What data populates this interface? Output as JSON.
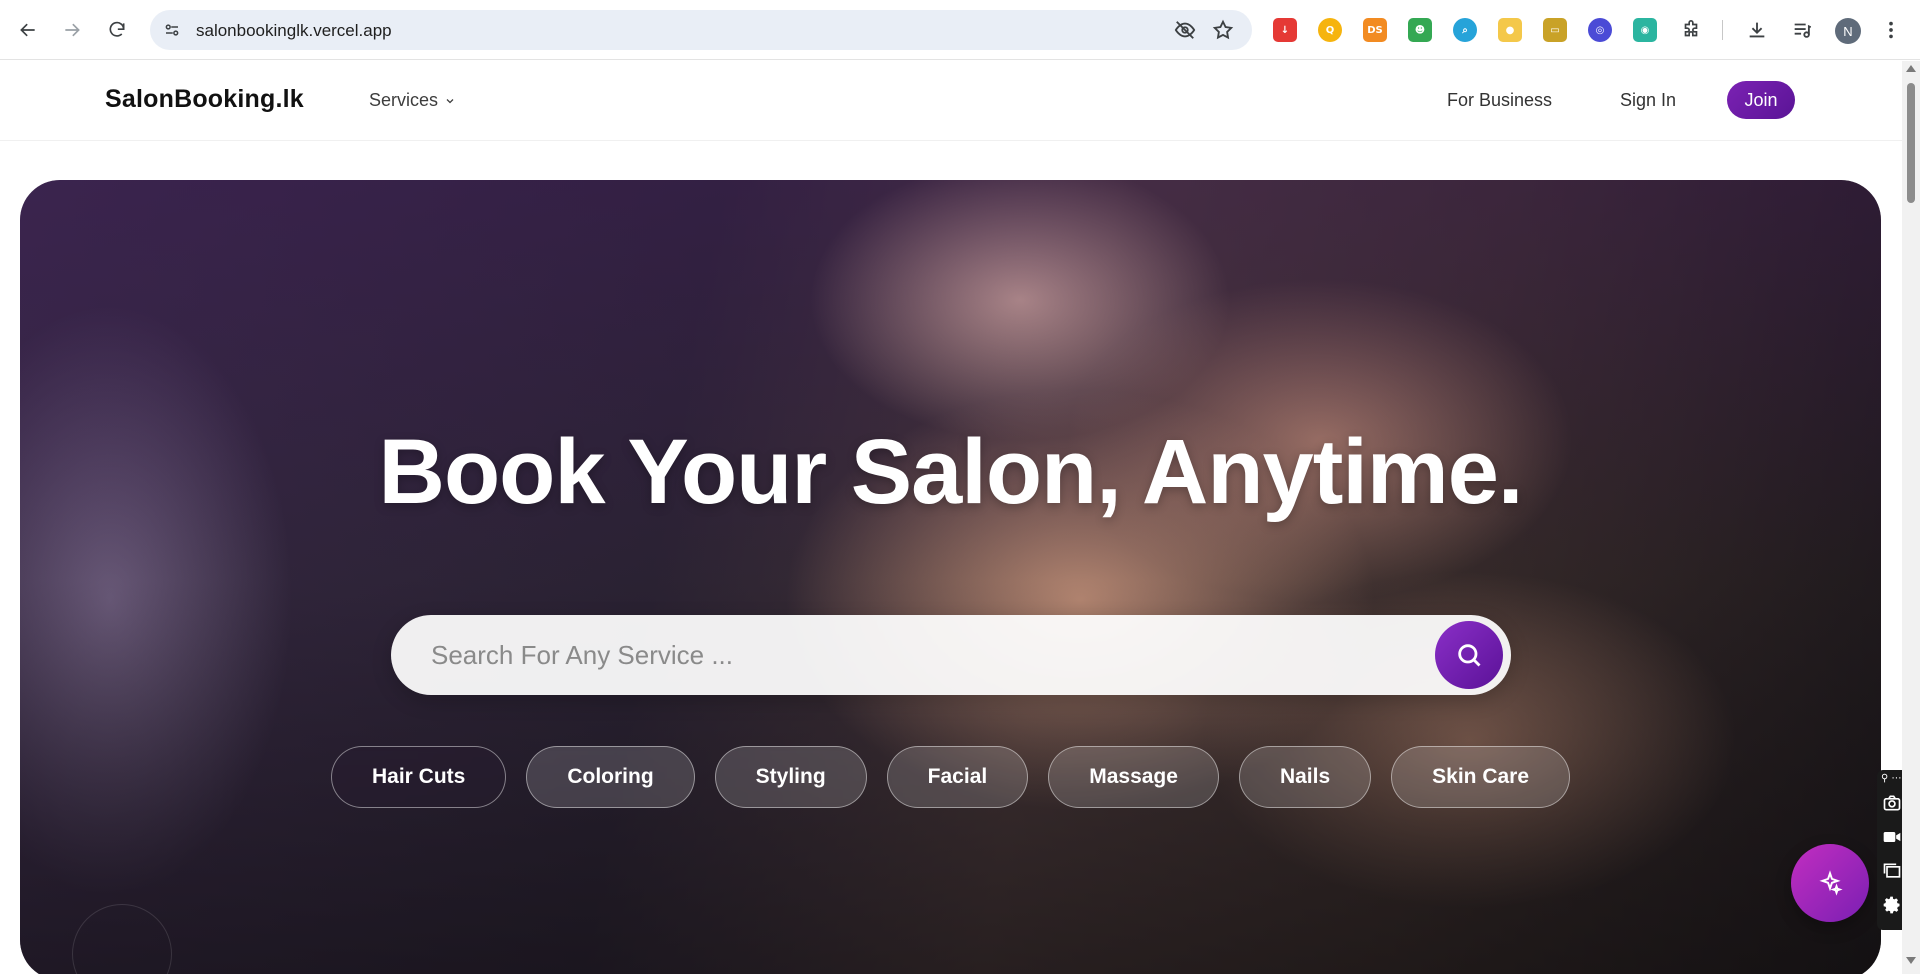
{
  "browser": {
    "url": "salonbookinglk.vercel.app",
    "profile_initial": "N",
    "extensions": [
      {
        "name": "download-extension-icon",
        "color": "#e53935",
        "label": "↓"
      },
      {
        "name": "q-extension-icon",
        "color": "#f6b40e",
        "label": "Q"
      },
      {
        "name": "ds-extension-icon",
        "color": "#f28b22",
        "label": "DS"
      },
      {
        "name": "robot-extension-icon",
        "color": "#34a853",
        "label": "☻"
      },
      {
        "name": "search-extension-icon",
        "color": "#26a3d9",
        "label": "⌕"
      },
      {
        "name": "cup-extension-icon",
        "color": "#f4c84a",
        "label": "●"
      },
      {
        "name": "folder-extension-icon",
        "color": "#c9a227",
        "label": "▭"
      },
      {
        "name": "target-extension-icon",
        "color": "#4b4bd6",
        "label": "◎"
      },
      {
        "name": "map-pin-extension-icon",
        "color": "#2bb5a0",
        "label": "◉"
      }
    ]
  },
  "header": {
    "logo": "SalonBooking.lk",
    "services_label": "Services",
    "for_business": "For Business",
    "sign_in": "Sign In",
    "join": "Join"
  },
  "hero": {
    "title": "Book Your Salon, Anytime.",
    "search_placeholder": "Search For Any Service ...",
    "categories": [
      "Hair Cuts",
      "Coloring",
      "Styling",
      "Facial",
      "Massage",
      "Nails",
      "Skin Care"
    ]
  },
  "colors": {
    "brand": "#6a1aa6",
    "fab": "#b22ac0"
  }
}
